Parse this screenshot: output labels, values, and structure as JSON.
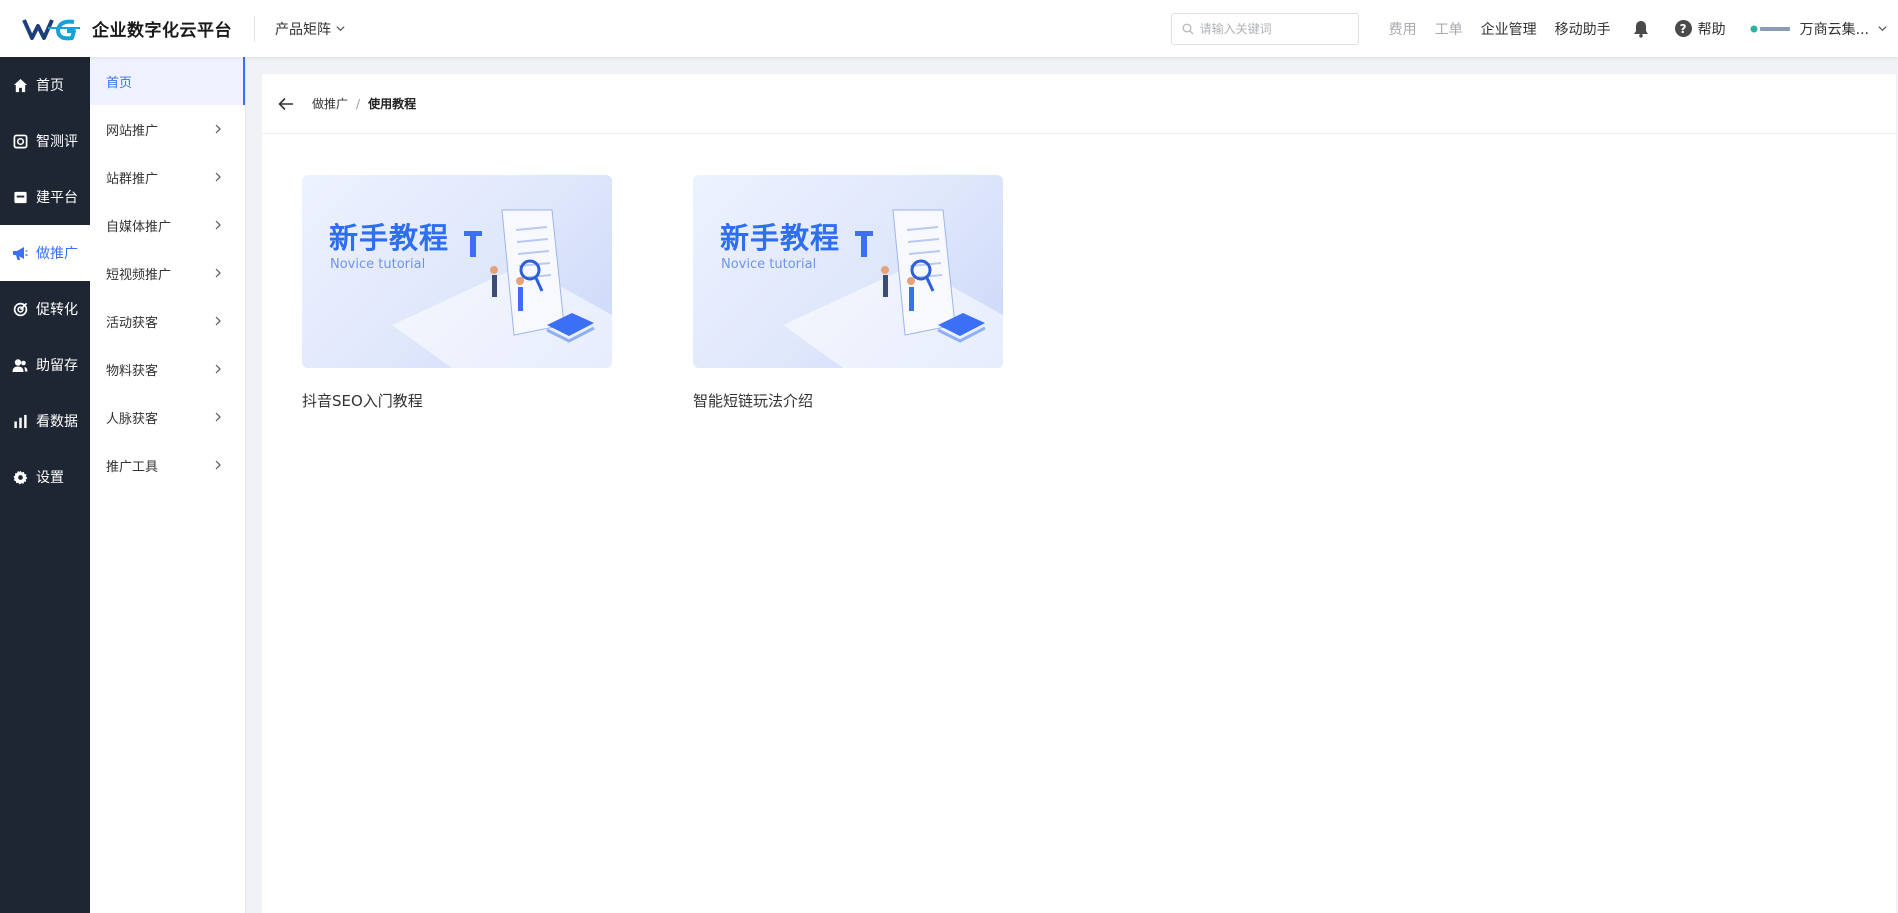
{
  "header": {
    "logo_title": "企业数字化云平台",
    "product_menu": "产品矩阵",
    "search_placeholder": "请输入关键词",
    "links": [
      {
        "label": "费用",
        "muted": true
      },
      {
        "label": "工单",
        "muted": true
      },
      {
        "label": "企业管理",
        "muted": false
      },
      {
        "label": "移动助手",
        "muted": false
      }
    ],
    "help_label": "帮助",
    "company_name": "万商云集..."
  },
  "sidebar1": {
    "items": [
      {
        "label": "首页",
        "icon": "home-icon"
      },
      {
        "label": "智测评",
        "icon": "evaluate-icon"
      },
      {
        "label": "建平台",
        "icon": "platform-icon"
      },
      {
        "label": "做推广",
        "icon": "megaphone-icon",
        "active": true
      },
      {
        "label": "促转化",
        "icon": "target-icon"
      },
      {
        "label": "助留存",
        "icon": "users-icon"
      },
      {
        "label": "看数据",
        "icon": "chart-icon"
      },
      {
        "label": "设置",
        "icon": "gear-icon"
      }
    ]
  },
  "sidebar2": {
    "items": [
      {
        "label": "首页",
        "active": true
      },
      {
        "label": "网站推广"
      },
      {
        "label": "站群推广"
      },
      {
        "label": "自媒体推广"
      },
      {
        "label": "短视频推广"
      },
      {
        "label": "活动获客"
      },
      {
        "label": "物料获客"
      },
      {
        "label": "人脉获客"
      },
      {
        "label": "推广工具"
      }
    ]
  },
  "breadcrumb": {
    "parent": "做推广",
    "separator": "/",
    "current": "使用教程"
  },
  "cards": [
    {
      "banner_cn": "新手教程",
      "banner_en": "Novice tutorial",
      "title": "抖音SEO入门教程"
    },
    {
      "banner_cn": "新手教程",
      "banner_en": "Novice tutorial",
      "title": "智能短链玩法介绍"
    }
  ],
  "colors": {
    "accent": "#3b6ff5",
    "sidebar_dark": "#1f2633"
  }
}
